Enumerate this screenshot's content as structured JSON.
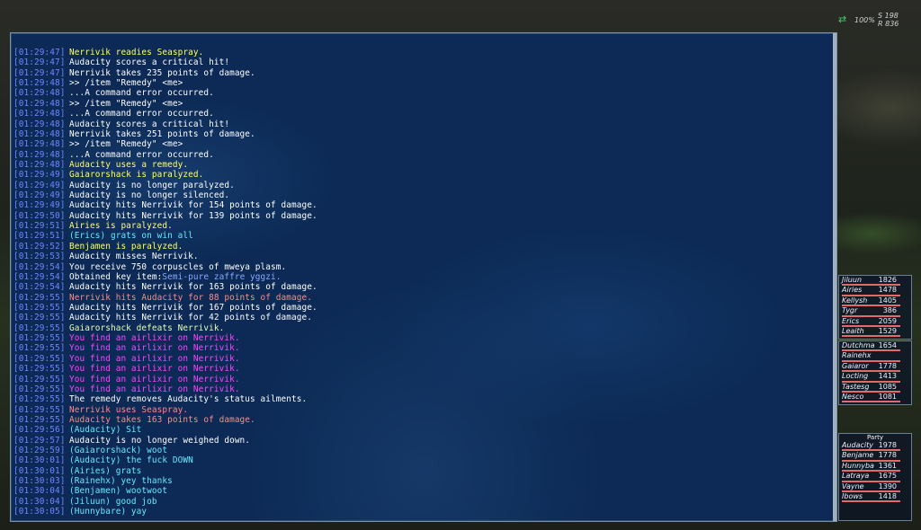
{
  "hud": {
    "speed": "100%",
    "s": "S 198",
    "r": "R 836"
  },
  "chat": [
    {
      "t": "[01:29:47]",
      "m": "Nerrivik readies Seaspray.",
      "c": "y"
    },
    {
      "t": "[01:29:47]",
      "m": "Audacity scores a critical hit!",
      "c": "w"
    },
    {
      "t": "[01:29:47]",
      "m": "Nerrivik takes 235 points of damage.",
      "c": "w"
    },
    {
      "t": "[01:29:48]",
      "m": ">> /item \"Remedy\" <me>",
      "c": "w"
    },
    {
      "t": "[01:29:48]",
      "m": "...A command error occurred.",
      "c": "w"
    },
    {
      "t": "[01:29:48]",
      "m": ">> /item \"Remedy\" <me>",
      "c": "w"
    },
    {
      "t": "[01:29:48]",
      "m": "...A command error occurred.",
      "c": "w"
    },
    {
      "t": "[01:29:48]",
      "m": "Audacity scores a critical hit!",
      "c": "w"
    },
    {
      "t": "[01:29:48]",
      "m": "Nerrivik takes 251 points of damage.",
      "c": "w"
    },
    {
      "t": "[01:29:48]",
      "m": ">> /item \"Remedy\" <me>",
      "c": "w"
    },
    {
      "t": "[01:29:48]",
      "m": "...A command error occurred.",
      "c": "w"
    },
    {
      "t": "[01:29:48]",
      "m": "Audacity uses a remedy.",
      "c": "y"
    },
    {
      "t": "[01:29:49]",
      "m": "Gaiarorshack is paralyzed.",
      "c": "y"
    },
    {
      "t": "[01:29:49]",
      "m": "Audacity is no longer paralyzed.",
      "c": "w"
    },
    {
      "t": "[01:29:49]",
      "m": "Audacity is no longer silenced.",
      "c": "w"
    },
    {
      "t": "[01:29:49]",
      "m": "Audacity hits Nerrivik for 154 points of damage.",
      "c": "w"
    },
    {
      "t": "[01:29:50]",
      "m": "Audacity hits Nerrivik for 139 points of damage.",
      "c": "w"
    },
    {
      "t": "[01:29:51]",
      "m": "Airies is paralyzed.",
      "c": "y"
    },
    {
      "t": "[01:29:51]",
      "m": "(Erics) grats on win all",
      "c": "c"
    },
    {
      "t": "[01:29:52]",
      "m": "Benjamen is paralyzed.",
      "c": "y"
    },
    {
      "t": "[01:29:53]",
      "m": "Audacity misses Nerrivik.",
      "c": "w"
    },
    {
      "t": "[01:29:54]",
      "m": "You receive 750 corpuscles of mweya plasm.",
      "c": "w"
    },
    {
      "t": "[01:29:54]",
      "m": "Obtained key item: ",
      "c": "w",
      "extra": "Semi-pure zaffre yggzi."
    },
    {
      "t": "[01:29:54]",
      "m": "Audacity hits Nerrivik for 163 points of damage.",
      "c": "w"
    },
    {
      "t": "[01:29:55]",
      "m": "Nerrivik hits Audacity for 88 points of damage.",
      "c": "r"
    },
    {
      "t": "[01:29:55]",
      "m": "Audacity hits Nerrivik for 167 points of damage.",
      "c": "w"
    },
    {
      "t": "[01:29:55]",
      "m": "Audacity hits Nerrivik for 42 points of damage.",
      "c": "w"
    },
    {
      "t": "[01:29:55]",
      "m": "Gaiarorshack defeats Nerrivik.",
      "c": "g"
    },
    {
      "t": "[01:29:55]",
      "m": "You find an airlixir on Nerrivik.",
      "c": "m"
    },
    {
      "t": "[01:29:55]",
      "m": "You find an airlixir on Nerrivik.",
      "c": "m"
    },
    {
      "t": "[01:29:55]",
      "m": "You find an airlixir on Nerrivik.",
      "c": "m"
    },
    {
      "t": "[01:29:55]",
      "m": "You find an airlixir on Nerrivik.",
      "c": "m"
    },
    {
      "t": "[01:29:55]",
      "m": "You find an airlixir on Nerrivik.",
      "c": "m"
    },
    {
      "t": "[01:29:55]",
      "m": "You find an airlixir on Nerrivik.",
      "c": "m"
    },
    {
      "t": "[01:29:55]",
      "m": "The remedy removes Audacity's status ailments.",
      "c": "w"
    },
    {
      "t": "[01:29:55]",
      "m": "Nerrivik uses Seaspray.",
      "c": "r"
    },
    {
      "t": "[01:29:55]",
      "m": "Audacity takes 163 points of damage.",
      "c": "r"
    },
    {
      "t": "[01:29:56]",
      "m": "(Audacity) Sit",
      "c": "c"
    },
    {
      "t": "[01:29:57]",
      "m": "Audacity is no longer weighed down.",
      "c": "w"
    },
    {
      "t": "[01:29:59]",
      "m": "(Gaiarorshack) woot",
      "c": "c"
    },
    {
      "t": "[01:30:01]",
      "m": "(Audacity) the fuck DOWN",
      "c": "c"
    },
    {
      "t": "[01:30:01]",
      "m": "(Airies) grats",
      "c": "c"
    },
    {
      "t": "[01:30:03]",
      "m": "(Rainehx) yey thanks",
      "c": "c"
    },
    {
      "t": "[01:30:04]",
      "m": "(Benjamen) wootwoot",
      "c": "c"
    },
    {
      "t": "[01:30:04]",
      "m": "(Jiluun) good job",
      "c": "c"
    },
    {
      "t": "[01:30:05]",
      "m": "(Hunnybare) yay",
      "c": "c"
    }
  ],
  "alliance1": [
    {
      "n": "Jiluun",
      "hp": "1826"
    },
    {
      "n": "Airies",
      "hp": "1478"
    },
    {
      "n": "Kellysh",
      "hp": "1405"
    },
    {
      "n": "Tygr",
      "hp": "386"
    },
    {
      "n": "Erics",
      "hp": "2059"
    },
    {
      "n": "Leaith",
      "hp": "1529"
    }
  ],
  "alliance2": [
    {
      "n": "Dutchma",
      "hp": "1654"
    },
    {
      "n": "Rainehx",
      "hp": ""
    },
    {
      "n": "Gaiaror",
      "hp": "1778"
    },
    {
      "n": "Locting",
      "hp": "1413"
    },
    {
      "n": "Tastesg",
      "hp": "1085"
    },
    {
      "n": "Nesco",
      "hp": "1081"
    }
  ],
  "party_title": "Party",
  "party": [
    {
      "n": "Audacity",
      "hp": "1978"
    },
    {
      "n": "Benjame",
      "hp": "1778"
    },
    {
      "n": "Hunnyba",
      "hp": "1361"
    },
    {
      "n": "Latraya",
      "hp": "1675"
    },
    {
      "n": "Vayne",
      "hp": "1390"
    },
    {
      "n": "Ibows",
      "hp": "1418"
    }
  ]
}
